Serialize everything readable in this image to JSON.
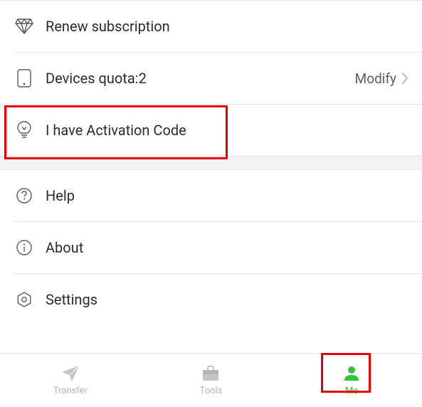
{
  "menu": {
    "renew": {
      "label": "Renew subscription"
    },
    "devicesQuota": {
      "label": "Devices quota:2",
      "action": "Modify"
    },
    "activation": {
      "label": "I have Activation Code"
    },
    "help": {
      "label": "Help"
    },
    "about": {
      "label": "About"
    },
    "settings": {
      "label": "Settings"
    }
  },
  "tabs": {
    "transfer": {
      "label": "Transfer"
    },
    "tools": {
      "label": "Tools"
    },
    "me": {
      "label": "Me"
    }
  },
  "colors": {
    "accent": "#3bc03b",
    "highlight": "#e60000",
    "text": "#2b2b2b",
    "muted": "#b8b8b8"
  }
}
